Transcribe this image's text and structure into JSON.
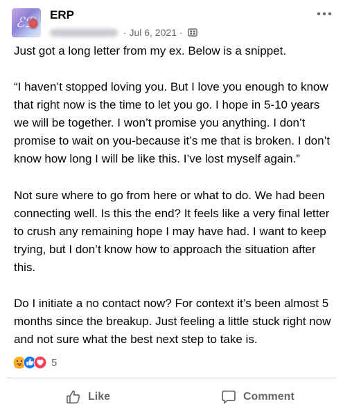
{
  "post": {
    "group_name": "ERP",
    "meta": " · Jul 6, 2021 · ",
    "paragraphs": [
      "Just got a long letter from my ex.  Below is a snippet.",
      "“I haven’t stopped loving you. But I love you enough to know that right now is the time to let you go.  I hope in 5-10 years we will be together. I won’t promise you anything.  I don’t promise to wait on you-because it’s me that is broken.  I don’t know how long I will be like this.  I’ve lost myself again.”",
      "Not sure where to go from here or what to do.  We had been connecting well.  Is this the end? It feels like a very final letter to crush any remaining hope I may have had.  I want to keep trying, but I don’t know how to approach the situation after this.",
      "Do I initiate a no contact now? For context it’s been almost 5 months since the breakup.  Just feeling a little stuck right now and not sure what the best next step to take is."
    ],
    "reactions": {
      "icons": [
        "care-icon",
        "like-icon",
        "love-icon"
      ],
      "count": "5"
    }
  },
  "actions": {
    "like_label": "Like",
    "comment_label": "Comment"
  },
  "colors": {
    "text": "#050505",
    "secondary_text": "#65676b",
    "like_blue": "#1877f2",
    "love_red": "#f33e58",
    "care_yellow": "#f7b125",
    "divider": "#ced0d4"
  }
}
